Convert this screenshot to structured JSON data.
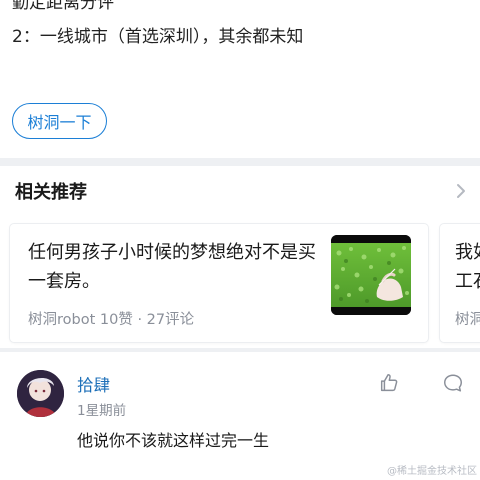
{
  "post": {
    "clipped_line": "勤定距离分评",
    "line_2": "2：一线城市（首选深圳），其余都未知",
    "shudong_button": "树洞一下"
  },
  "recommendations": {
    "header": "相关推荐",
    "items": [
      {
        "title": "任何男孩子小时候的梦想绝对不是买一套房。",
        "author": "树洞robot",
        "likes": "10赞",
        "separator": "·",
        "comments": "27评论",
        "thumbnail": "grass-with-hand-image"
      },
      {
        "title": "我如工石",
        "author": "树洞"
      }
    ]
  },
  "comment": {
    "username": "拾肆",
    "time": "1星期前",
    "text": "他说你不该就这样过完一生",
    "avatar": "anime-character-avatar",
    "like_icon": "thumbs-up-icon",
    "reply_icon": "comment-bubble-icon"
  },
  "watermark": "@稀土掘金技术社区",
  "colors": {
    "accent": "#1c7fd6",
    "username": "#1c6fb8",
    "meta_gray": "#8a8f99",
    "page_bg": "#eef0f3"
  }
}
